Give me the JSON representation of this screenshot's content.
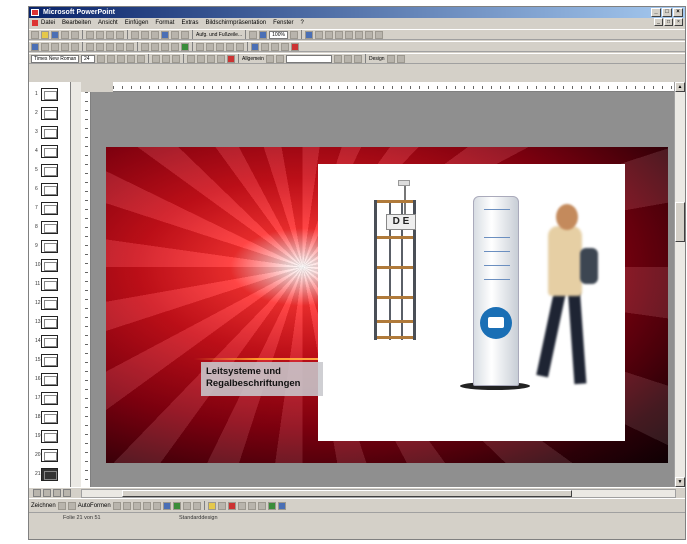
{
  "window": {
    "title": "Microsoft PowerPoint",
    "controls": {
      "minimize": "_",
      "maximize": "□",
      "close": "×"
    }
  },
  "menubar": {
    "items": [
      "Datei",
      "Bearbeiten",
      "Ansicht",
      "Einfügen",
      "Format",
      "Extras",
      "Bildschirmpräsentation",
      "Fenster",
      "?"
    ]
  },
  "toolbar": {
    "zoom": "100%",
    "font_name": "Times New Roman",
    "font_size": "24",
    "tasks_label": "Aufg. und Fußzeile...",
    "align_label": "Allgemein",
    "design_label": "Design"
  },
  "slides_panel": {
    "numbers": [
      "1",
      "2",
      "3",
      "4",
      "5",
      "6",
      "7",
      "8",
      "9",
      "10",
      "11",
      "12",
      "13",
      "14",
      "15",
      "16",
      "17",
      "18",
      "19",
      "20",
      "21"
    ],
    "selected_index": 21
  },
  "slide": {
    "caption_line1": "Leitsysteme und",
    "caption_line2": "Regalbeschriftungen",
    "shelf_sign": "D E"
  },
  "drawbar": {
    "draw_label": "Zeichnen",
    "autoshapes_label": "AutoFormen"
  },
  "status": {
    "slide_position": "Folie 21 von 51",
    "design_name": "Standarddesign"
  }
}
